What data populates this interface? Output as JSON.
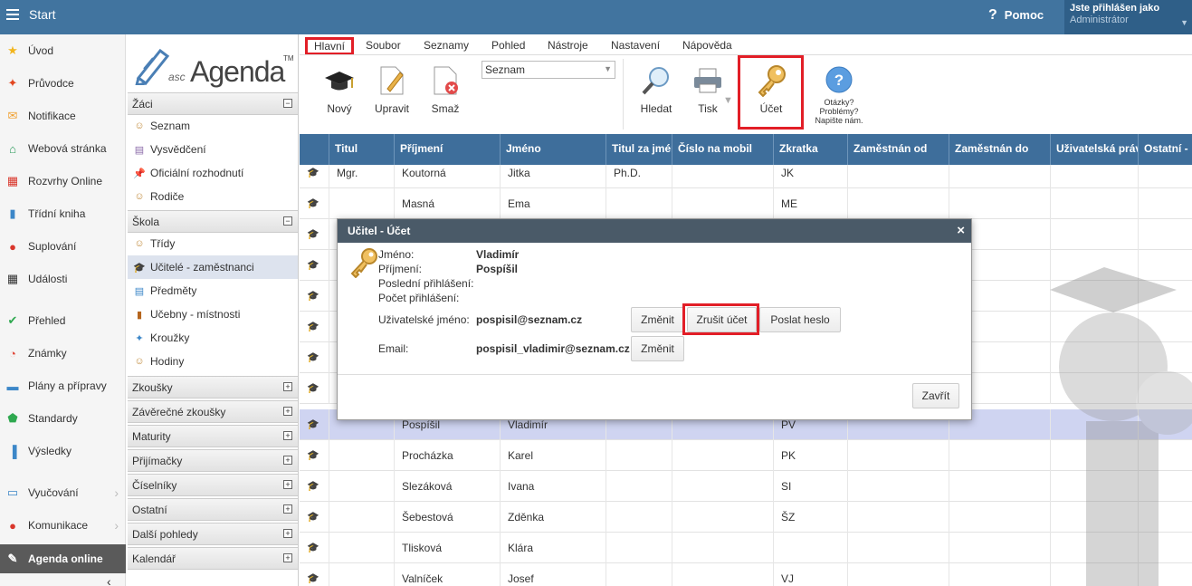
{
  "topbar": {
    "start": "Start",
    "help": "Pomoc",
    "user_title": "Jste přihlášen jako",
    "user_name": "Administrátor"
  },
  "sidebar": {
    "items": [
      {
        "label": "Úvod",
        "icon": "star-icon",
        "color": "#f2b51d",
        "glyph": "★"
      },
      {
        "label": "Průvodce",
        "icon": "wand-icon",
        "color": "#e2461f",
        "glyph": "✦"
      },
      {
        "label": "Notifikace",
        "icon": "envelope-icon",
        "color": "#f0a030",
        "glyph": "✉"
      },
      {
        "label": "Webová stránka",
        "icon": "home-icon",
        "color": "#2a9a5a",
        "glyph": "⌂"
      },
      {
        "label": "Rozvrhy Online",
        "icon": "grid-icon",
        "color": "#d9362b",
        "glyph": "▦"
      },
      {
        "label": "Třídní kniha",
        "icon": "book-icon",
        "color": "#3c87c8",
        "glyph": "▮"
      },
      {
        "label": "Suplování",
        "icon": "person-icon",
        "color": "#d9362b",
        "glyph": "●"
      },
      {
        "label": "Události",
        "icon": "calendar-icon",
        "color": "#333333",
        "glyph": "▦"
      },
      {
        "label": "Přehled",
        "icon": "check-circle-icon",
        "color": "#2ea84f",
        "glyph": "✔"
      },
      {
        "label": "Známky",
        "icon": "grades-icon",
        "color": "#e0483a",
        "glyph": "◔"
      },
      {
        "label": "Plány a přípravy",
        "icon": "briefcase-icon",
        "color": "#3c87c8",
        "glyph": "▬"
      },
      {
        "label": "Standardy",
        "icon": "shield-icon",
        "color": "#2ea84f",
        "glyph": "⬟"
      },
      {
        "label": "Výsledky",
        "icon": "bar-chart-icon",
        "color": "#3c87c8",
        "glyph": "▐"
      },
      {
        "label": "Vyučování",
        "icon": "open-book-icon",
        "color": "#3c87c8",
        "glyph": "▭"
      },
      {
        "label": "Komunikace",
        "icon": "chat-icon",
        "color": "#d9362b",
        "glyph": "●"
      },
      {
        "label": "Agenda online",
        "icon": "pen-icon",
        "color": "#ffffff",
        "glyph": "✎"
      }
    ]
  },
  "logo": {
    "asc": "asc",
    "agenda": "Agenda",
    "tm": "TM"
  },
  "navpanel": {
    "zaci": "Žáci",
    "zaci_items": [
      {
        "label": "Seznam",
        "glyph": "☺",
        "color": "#c08a3a"
      },
      {
        "label": "Vysvědčení",
        "glyph": "▤",
        "color": "#8a6aa8"
      },
      {
        "label": "Oficiální rozhodnutí",
        "glyph": "📌",
        "color": "#d9362b"
      },
      {
        "label": "Rodiče",
        "glyph": "☺",
        "color": "#c08a3a"
      }
    ],
    "skola": "Škola",
    "skola_items": [
      {
        "label": "Třídy",
        "glyph": "☺",
        "color": "#c08a3a"
      },
      {
        "label": "Učitelé - zaměstnanci",
        "glyph": "🎓",
        "color": "#222222"
      },
      {
        "label": "Předměty",
        "glyph": "▤",
        "color": "#3c87c8"
      },
      {
        "label": "Učebny - místnosti",
        "glyph": "▮",
        "color": "#b5651d"
      },
      {
        "label": "Kroužky",
        "glyph": "✦",
        "color": "#3c87c8"
      },
      {
        "label": "Hodiny",
        "glyph": "☺",
        "color": "#c08a3a"
      }
    ],
    "collapsed": [
      "Zkoušky",
      "Závěrečné zkoušky",
      "Maturity",
      "Přijímačky",
      "Číselníky",
      "Ostatní",
      "Další pohledy",
      "Kalendář"
    ]
  },
  "tabs": [
    "Hlavní",
    "Soubor",
    "Seznamy",
    "Pohled",
    "Nástroje",
    "Nastavení",
    "Nápověda"
  ],
  "ribbon": {
    "new": "Nový",
    "edit": "Upravit",
    "delete": "Smaž",
    "view_select": "Seznam",
    "search": "Hledat",
    "print": "Tisk",
    "account": "Účet",
    "questions": "Otázky?",
    "problems": "Problémy?",
    "write": "Napište nám."
  },
  "table": {
    "headers": [
      "Titul",
      "Příjmení",
      "Jméno",
      "Titul za jménem",
      "Číslo na mobil",
      "Zkratka",
      "Zaměstnán od",
      "Zaměstnán do",
      "Uživatelská práva",
      "Ostatní - "
    ],
    "rows": [
      {
        "titul": "Mgr.",
        "prijmeni": "Koutorná",
        "jmeno": "Jitka",
        "titul_za": "Ph.D.",
        "zkratka": "JK"
      },
      {
        "titul": "",
        "prijmeni": "Masná",
        "jmeno": "Ema",
        "titul_za": "",
        "zkratka": "ME"
      },
      {
        "titul": "",
        "prijmeni": "",
        "jmeno": "",
        "titul_za": "",
        "zkratka": ""
      },
      {
        "titul": "",
        "prijmeni": "",
        "jmeno": "",
        "titul_za": "",
        "zkratka": ""
      },
      {
        "titul": "",
        "prijmeni": "",
        "jmeno": "",
        "titul_za": "",
        "zkratka": ""
      },
      {
        "titul": "",
        "prijmeni": "",
        "jmeno": "",
        "titul_za": "",
        "zkratka": ""
      },
      {
        "titul": "",
        "prijmeni": "",
        "jmeno": "",
        "titul_za": "",
        "zkratka": ""
      },
      {
        "titul": "",
        "prijmeni": "",
        "jmeno": "",
        "titul_za": "",
        "zkratka": ""
      },
      {
        "titul": "",
        "prijmeni": "Pospíšil",
        "jmeno": "Vladimír",
        "titul_za": "",
        "zkratka": "PV"
      },
      {
        "titul": "",
        "prijmeni": "Procházka",
        "jmeno": "Karel",
        "titul_za": "",
        "zkratka": "PK"
      },
      {
        "titul": "",
        "prijmeni": "Slezáková",
        "jmeno": "Ivana",
        "titul_za": "",
        "zkratka": "SI"
      },
      {
        "titul": "",
        "prijmeni": "Šebestová",
        "jmeno": "Zděnka",
        "titul_za": "",
        "zkratka": "ŠZ"
      },
      {
        "titul": "",
        "prijmeni": "Tlisková",
        "jmeno": "Klára",
        "titul_za": "",
        "zkratka": ""
      },
      {
        "titul": "",
        "prijmeni": "Valníček",
        "jmeno": "Josef",
        "titul_za": "",
        "zkratka": "VJ"
      }
    ]
  },
  "dialog": {
    "title": "Učitel - Účet",
    "close": "×",
    "jmeno_label": "Jméno:",
    "jmeno": "Vladimír",
    "prijmeni_label": "Příjmení:",
    "prijmeni": "Pospíšil",
    "posledni_label": "Poslední přihlášení:",
    "pocet_label": "Počet přihlášení:",
    "username_label": "Uživatelské jméno:",
    "username": "pospisil@seznam.cz",
    "email_label": "Email:",
    "email": "pospisil_vladimir@seznam.cz",
    "zmenit": "Změnit",
    "zrusit": "Zrušit účet",
    "poslat": "Poslat heslo",
    "zavrit": "Zavřít"
  }
}
